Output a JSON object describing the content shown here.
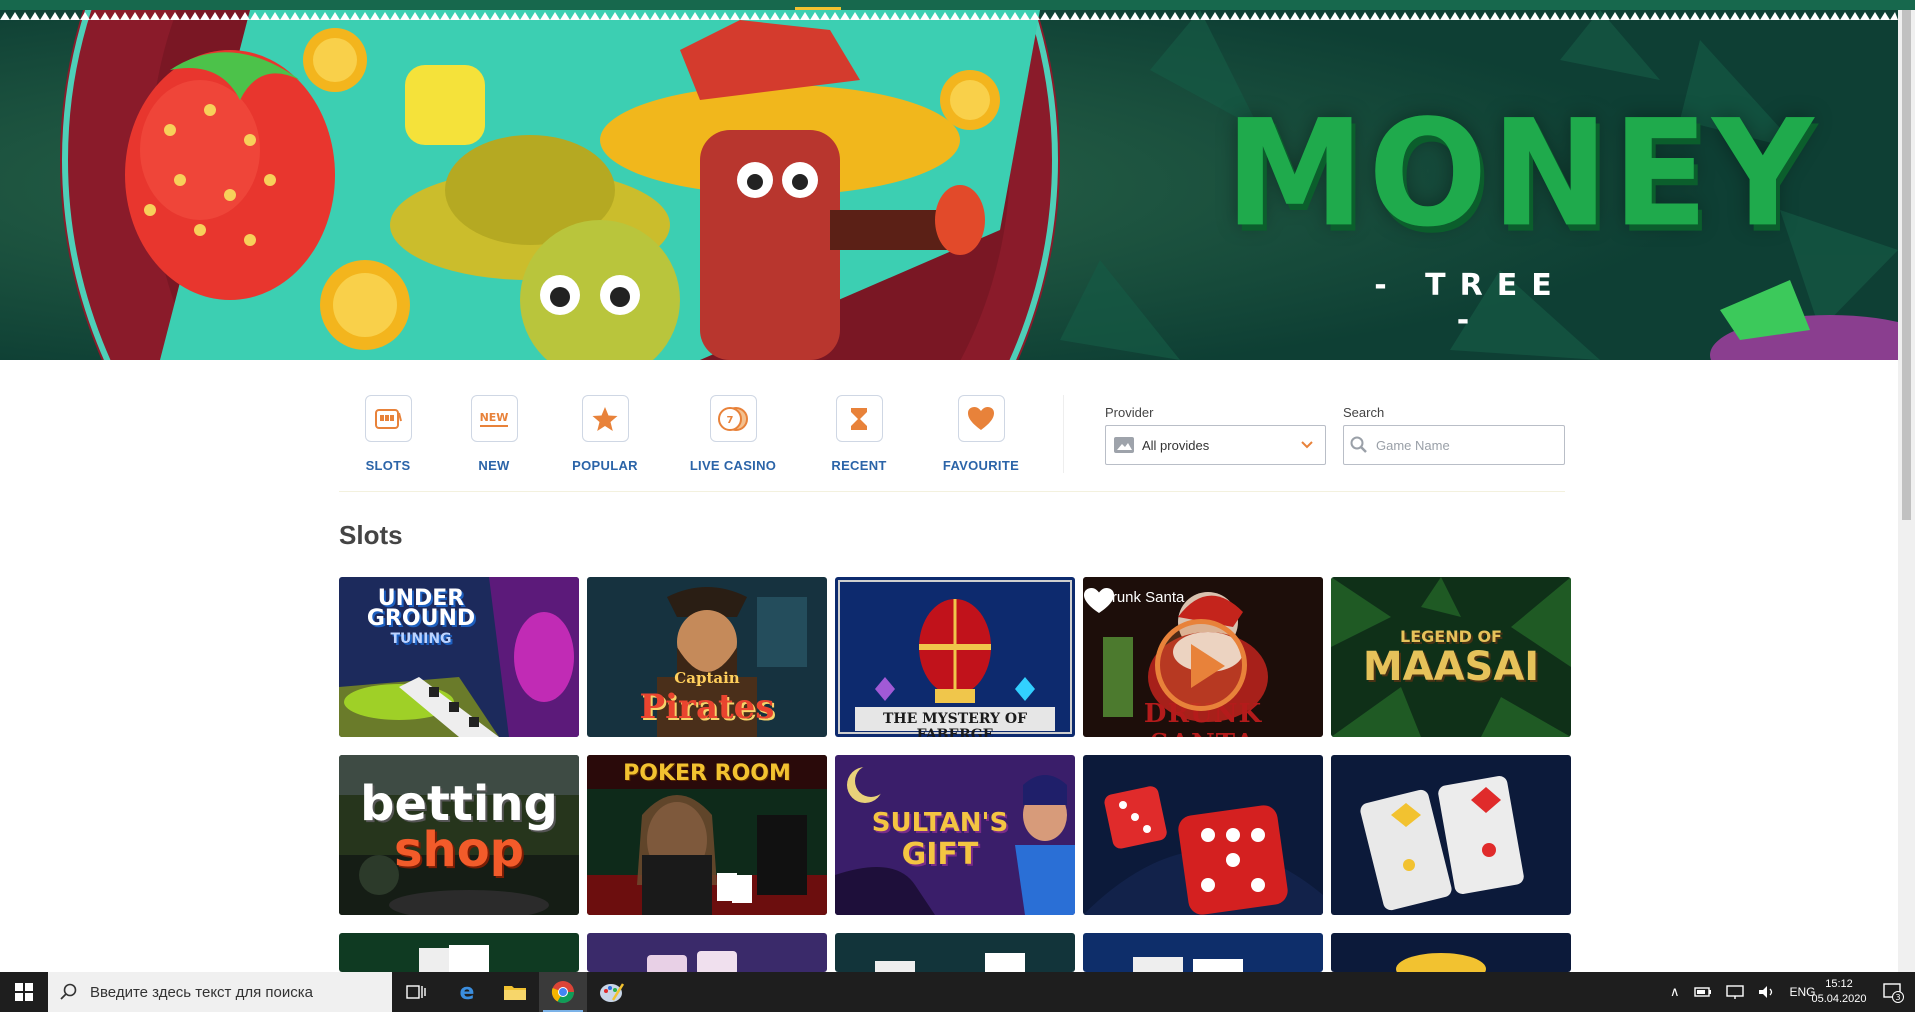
{
  "banner": {
    "title": "MONEY",
    "subtitle": "- TREE -"
  },
  "categories": [
    {
      "label": "SLOTS",
      "icon": "slot-machine-icon"
    },
    {
      "label": "NEW",
      "icon": "new-badge-icon",
      "icon_text": "NEW"
    },
    {
      "label": "POPULAR",
      "icon": "star-icon"
    },
    {
      "label": "LIVE CASINO",
      "icon": "chips-icon"
    },
    {
      "label": "RECENT",
      "icon": "hourglass-icon"
    },
    {
      "label": "FAVOURITE",
      "icon": "heart-icon"
    }
  ],
  "filters": {
    "provider_label": "Provider",
    "provider_value": "All provides",
    "search_label": "Search",
    "search_placeholder": "Game Name"
  },
  "section": {
    "title": "Slots"
  },
  "games": [
    {
      "title_art": [
        "UNDER",
        "GROUND",
        "TUNING"
      ]
    },
    {
      "title_art": [
        "Captain",
        "Pirates"
      ]
    },
    {
      "title_art": [
        "THE MYSTERY OF FABERGE"
      ]
    },
    {
      "overlay_name": "Drunk Santa",
      "title_art": [
        "DRUNK SANTA"
      ],
      "hovered": true
    },
    {
      "title_art": [
        "LEGEND OF",
        "MAASAI"
      ]
    },
    {
      "title_art": [
        "betting",
        "shop"
      ]
    },
    {
      "title_art": [
        "POKER ROOM"
      ]
    },
    {
      "title_art": [
        "SULTAN'S",
        "GIFT"
      ]
    },
    {
      "title_art": []
    },
    {
      "title_art": []
    }
  ],
  "taskbar": {
    "search_placeholder": "Введите здесь текст для поиска",
    "language": "ENG",
    "time": "15:12",
    "date": "05.04.2020",
    "notifications": "3"
  },
  "colors": {
    "accent_orange": "#e8823a",
    "nav_blue": "#2b64a8",
    "banner_green": "#1faa4c"
  }
}
